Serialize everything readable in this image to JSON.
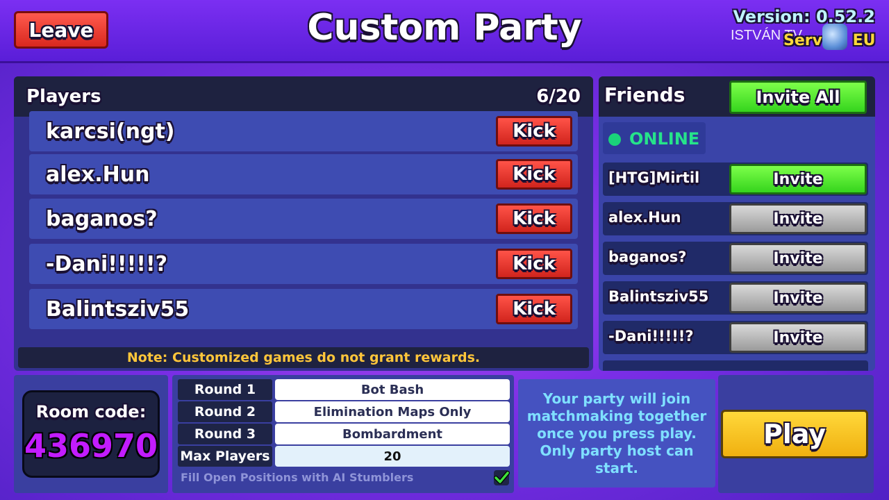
{
  "header": {
    "leave_label": "Leave",
    "title": "Custom Party",
    "version": "Version: 0.52.2",
    "watermark": "ISTVÁN TV",
    "server_label": "Serv",
    "server_region": "EU"
  },
  "players": {
    "title": "Players",
    "count": "6/20",
    "kick_label": "Kick",
    "list": [
      "karcsi(ngt)",
      "alex.Hun",
      "baganos?",
      "-Dani!!!!!?",
      "Balintsziv55"
    ]
  },
  "note": "Note: Customized games do not grant rewards.",
  "friends": {
    "title": "Friends",
    "invite_all_label": "Invite All",
    "online_label": "ONLINE",
    "invite_label": "Invite",
    "list": [
      {
        "name": "[HTG]Mirtil",
        "state": "highlighted"
      },
      {
        "name": "alex.Hun",
        "state": "default"
      },
      {
        "name": "baganos?",
        "state": "default"
      },
      {
        "name": "Balintsziv55",
        "state": "default"
      },
      {
        "name": "-Dani!!!!!?",
        "state": "default"
      }
    ]
  },
  "room": {
    "label": "Room code:",
    "code": "436970"
  },
  "settings": {
    "rounds": [
      {
        "label": "Round 1",
        "value": "Bot Bash"
      },
      {
        "label": "Round 2",
        "value": "Elimination Maps Only"
      },
      {
        "label": "Round 3",
        "value": "Bombardment"
      }
    ],
    "max_players_label": "Max Players",
    "max_players_value": "20",
    "fill_label": "Fill Open Positions with AI Stumblers",
    "fill_checked": true
  },
  "info_text": "Your party will join matchmaking together once you press play. Only party host can start.",
  "play_label": "Play",
  "colors": {
    "accent_purple": "#7b2ff2",
    "kick_red": "#d1241d",
    "invite_green": "#35d41d",
    "play_yellow": "#ffd83a",
    "room_code": "#c21cff",
    "note_text": "#ffc63a",
    "online_green": "#26e38a"
  }
}
